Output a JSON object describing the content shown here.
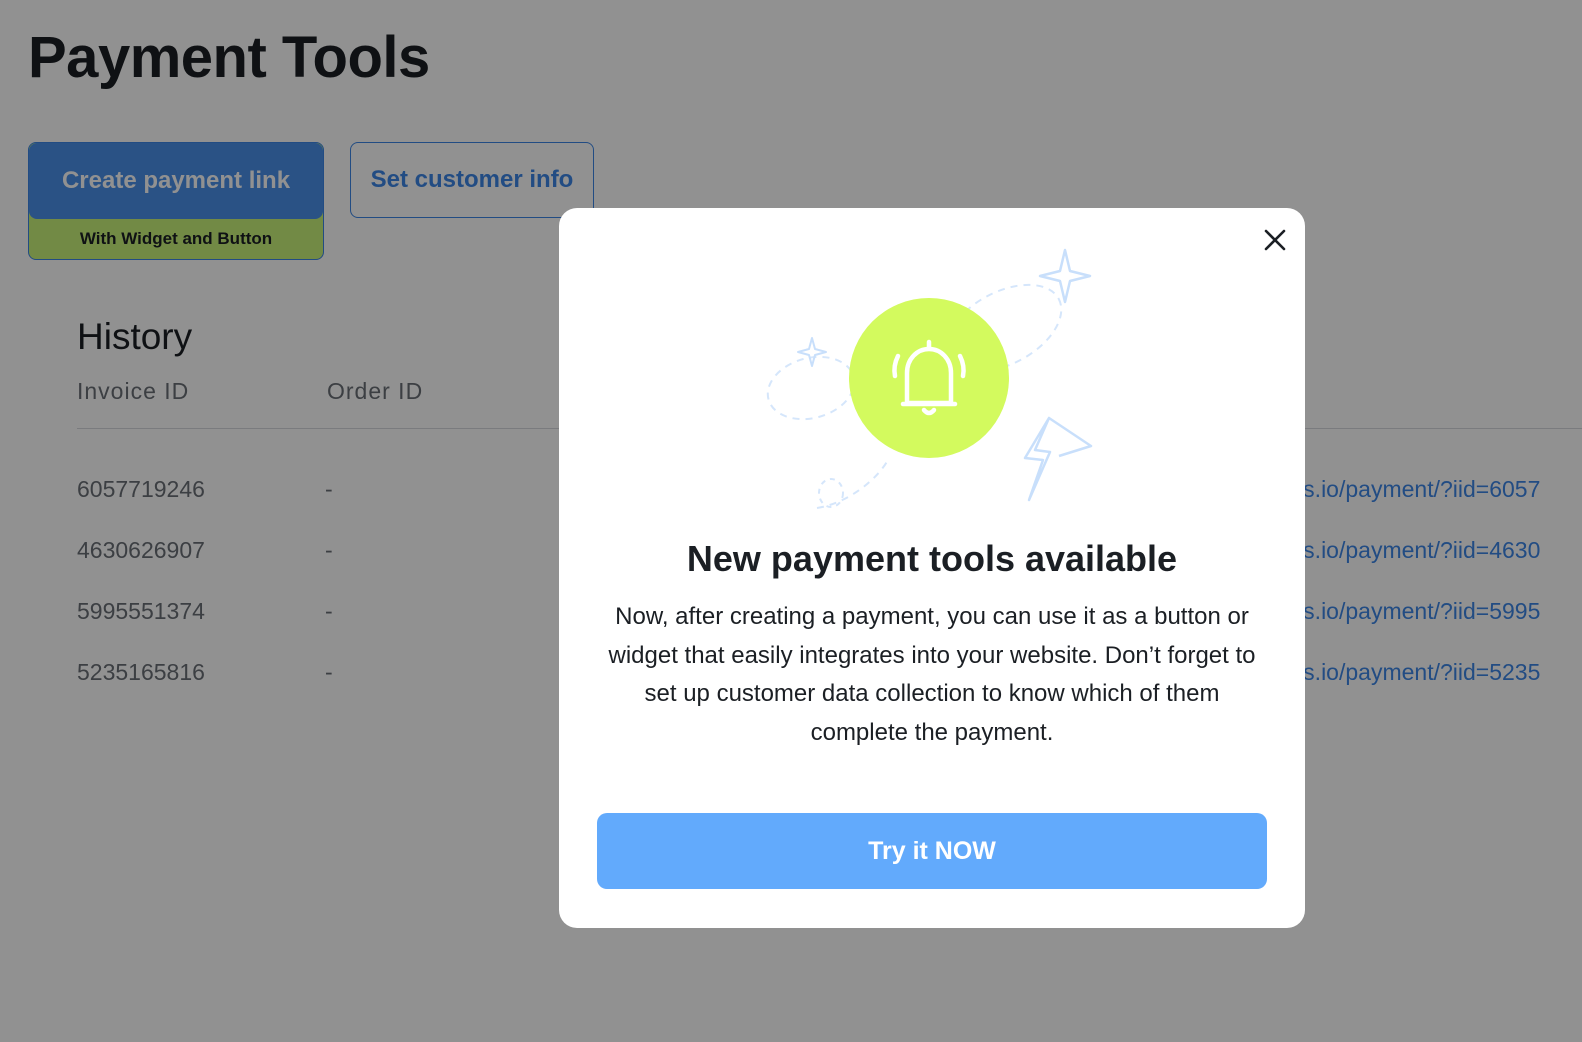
{
  "page": {
    "title": "Payment Tools",
    "create_button": {
      "label": "Create payment link",
      "sublabel": "With Widget and Button"
    },
    "customer_button": {
      "label": "Set customer info"
    }
  },
  "history": {
    "title": "History",
    "columns": [
      "Invoice ID",
      "Order ID"
    ],
    "rows": [
      {
        "invoice_id": "6057719246",
        "order_id": "-",
        "link": "nts.io/payment/?iid=6057"
      },
      {
        "invoice_id": "4630626907",
        "order_id": "-",
        "link": "nts.io/payment/?iid=4630"
      },
      {
        "invoice_id": "5995551374",
        "order_id": "-",
        "link": "nts.io/payment/?iid=5995"
      },
      {
        "invoice_id": "5235165816",
        "order_id": "-",
        "link": "nts.io/payment/?iid=5235"
      }
    ]
  },
  "modal": {
    "title": "New payment tools available",
    "body": "Now, after creating a payment, you can use it as a button or widget that easily integrates into your website. Don’t forget to set up customer data collection to know which of them complete the payment.",
    "cta_label": "Try it NOW",
    "icons": [
      "close-icon",
      "bell-icon",
      "sparkle-icon",
      "lightning-icon"
    ]
  },
  "colors": {
    "accent_blue": "#3d86e6",
    "cta_blue": "#62aafc",
    "bell_green": "#d3fa5e",
    "sub_green": "#c9f27a",
    "overlay": "rgba(0,0,0,0.43)"
  }
}
